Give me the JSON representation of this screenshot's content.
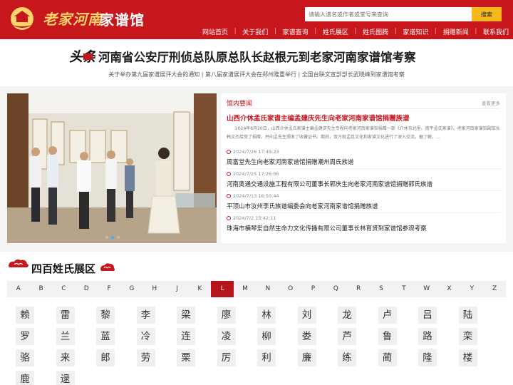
{
  "site": {
    "logo_script": "老家河南",
    "logo_name": "家谱馆"
  },
  "search": {
    "placeholder": "请输入谱名或作者或堂号来查询",
    "button": "搜索"
  },
  "nav": [
    "网站首页",
    "关于我们",
    "家谱查询",
    "姓氏展区",
    "姓氏图腾",
    "家谱知识",
    "捐赠新闻",
    "联系我们"
  ],
  "headline": {
    "badge": "头条",
    "title": "河南省公安厅刑侦总队原总队长赵根元到老家河南家谱馆考察",
    "subline": "关于举办第九届家谱展评大会的通知 | 第八届家谱展评大会在郑州隆重举行 | 全国台联文宣部部长武晓峰到家谱馆考察"
  },
  "news": {
    "section_title": "馆内要闻",
    "more": "查看更多",
    "feature_title": "山西介休孟氏家谱主编孟建庆先生向老家河南家谱馆捐赠族谱",
    "feature_body": "2024年8月20日，山西介休孟氏家谱主编孟建庆先生专程向老家河南家谱馆捐赠一部《介休东北里、南平孟氏家谱》。老家河南家谱馆副馆长韩文杰接受了捐赠，并向孟先生颁发了收藏证书。期间，双方就孟姓文化和家谱文化进行了深入交流。据了解，...",
    "items": [
      {
        "date": "2024/7/26 17:49:23",
        "title": "周富堂先生向老家河南家谱馆捐赠潮州周氏族谱"
      },
      {
        "date": "2024/7/25 17:26:06",
        "title": "河南奥通交通设施工程有限公司董事长郭庆生向老家河南家谱馆捐赠郭氏族谱"
      },
      {
        "date": "2024/7/13 16:50:44",
        "title": "平顶山市汝州李氏族谱编委会向老家河南家谱馆捐赠族谱"
      },
      {
        "date": "2024/7/2 15:42:11",
        "title": "珠海市横琴爱自然生命力文化传播有限公司董事长林育贤到家谱馆参观考察"
      }
    ]
  },
  "surnames": {
    "title": "四百姓氏展区",
    "letters": [
      "A",
      "B",
      "C",
      "D",
      "F",
      "G",
      "H",
      "J",
      "K",
      "L",
      "M",
      "N",
      "O",
      "P",
      "Q",
      "R",
      "S",
      "T",
      "W",
      "X",
      "Y",
      "Z"
    ],
    "active_letter": "L",
    "names": [
      "赖",
      "雷",
      "黎",
      "李",
      "梁",
      "廖",
      "林",
      "刘",
      "龙",
      "卢",
      "吕",
      "陆",
      "罗",
      "兰",
      "蓝",
      "冷",
      "连",
      "凌",
      "柳",
      "娄",
      "芦",
      "鲁",
      "路",
      "栾",
      "骆",
      "来",
      "郎",
      "劳",
      "栗",
      "厉",
      "利",
      "廉",
      "练",
      "蔺",
      "隆",
      "楼",
      "鹿",
      "逯"
    ]
  },
  "colors": {
    "brand_red": "#c8161d",
    "search_button": "#f6b81b",
    "gold": "#ffd66b"
  }
}
